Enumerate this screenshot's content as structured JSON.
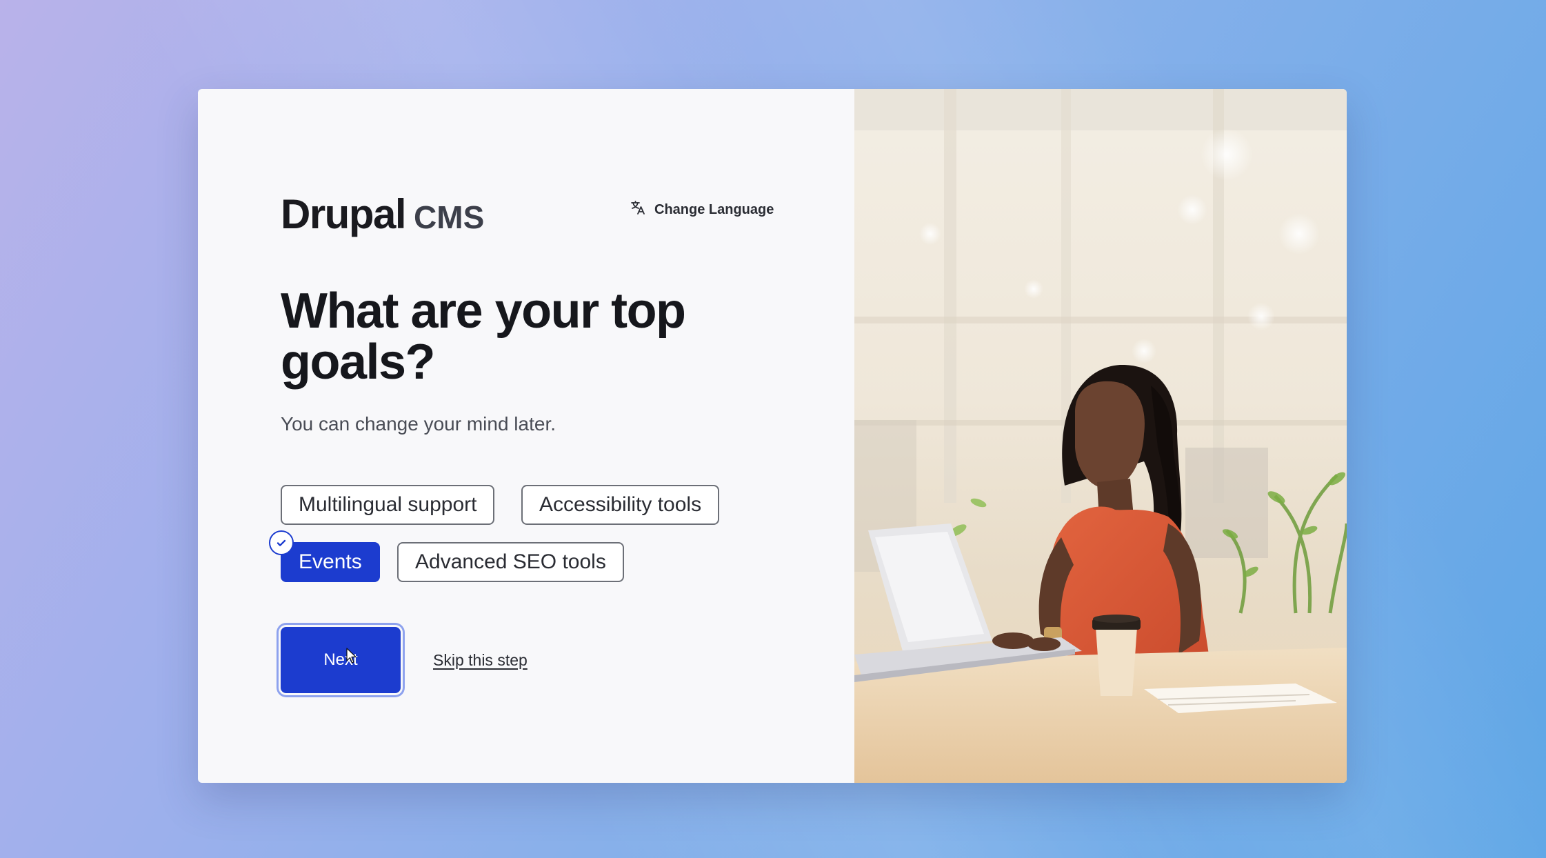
{
  "branding": {
    "logo_main": "Drupal",
    "logo_sub": "CMS"
  },
  "header": {
    "change_language_label": "Change Language",
    "translate_icon": "translate-icon"
  },
  "question": {
    "title": "What are your top goals?",
    "subtitle": "You can change your mind later."
  },
  "goals": [
    {
      "label": "Multilingual support",
      "selected": false
    },
    {
      "label": "Accessibility tools",
      "selected": false
    },
    {
      "label": "Events",
      "selected": true
    },
    {
      "label": "Advanced SEO tools",
      "selected": false
    }
  ],
  "actions": {
    "next_label": "Next",
    "skip_label": "Skip this step"
  },
  "colors": {
    "primary": "#1c3ccf",
    "chip_border": "#6c6f77",
    "text_dark": "#16171c"
  },
  "image": {
    "icon": "photo-woman-laptop"
  }
}
